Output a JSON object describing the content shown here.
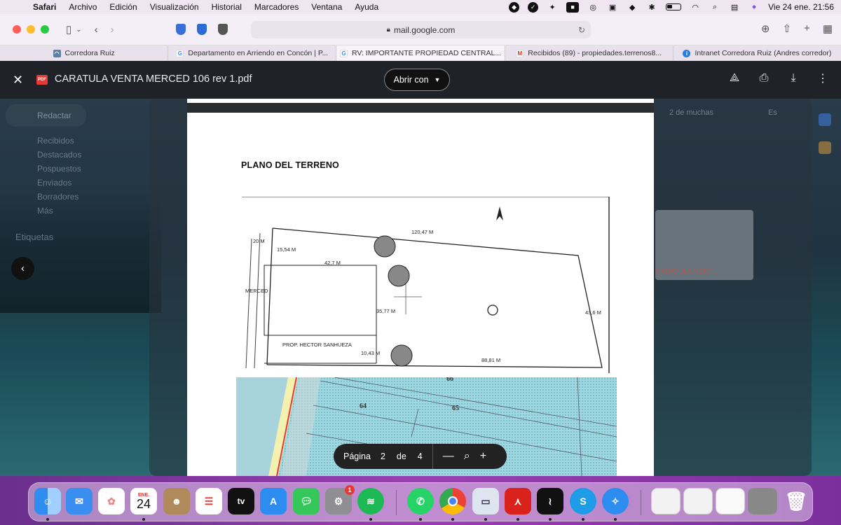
{
  "menubar": {
    "app": "Safari",
    "items": [
      "Archivo",
      "Edición",
      "Visualización",
      "Historial",
      "Marcadores",
      "Ventana",
      "Ayuda"
    ],
    "clock": "Vie 24 ene.  21:56"
  },
  "toolbar": {
    "url": "mail.google.com"
  },
  "tabs": [
    {
      "title": "Corredora Ruiz",
      "favicon": "corredora-icon"
    },
    {
      "title": "Departamento en Arriendo en Concón | P...",
      "favicon": "google-icon"
    },
    {
      "title": "RV: IMPORTANTE PROPIEDAD CENTRAL...",
      "favicon": "google-icon"
    },
    {
      "title": "Recibidos (89) - propiedades.terrenos8...",
      "favicon": "gmail-icon"
    },
    {
      "title": "Intranet Corredora Ruiz (Andres corredor)",
      "favicon": "intranet-icon"
    }
  ],
  "gmail": {
    "compose": "Redactar",
    "folders": [
      "Recibidos",
      "Destacados",
      "Pospuestos",
      "Enviados",
      "Borradores",
      "Más"
    ],
    "labels": "Etiquetas",
    "pager": "2 de muchas",
    "lang": "Es",
    "attachment": "CARATULA VENT..."
  },
  "viewer": {
    "filename": "CARATULA VENTA MERCED 106 rev 1.pdf",
    "open_with": "Abrir con"
  },
  "pdf": {
    "title": "PLANO DEL TERRENO",
    "labels": {
      "top": "120,47 M",
      "front": "20 M",
      "left_top": "15,54 M",
      "inner_top": "42,7 M",
      "inner_side": "35,77 M",
      "right": "43,6 M",
      "street": "MERCED",
      "neighbor": "PROP. HECTOR SANHUEZA",
      "bottom_left": "10,43 M",
      "bottom": "88,81 M"
    },
    "map_lots": [
      "64",
      "65",
      "66"
    ]
  },
  "pager": {
    "label": "Página",
    "current": "2",
    "of": "de",
    "total": "4"
  },
  "dock": {
    "calendar_month": "ENE.",
    "calendar_day": "24",
    "tv_label": "tv",
    "settings_badge": "1"
  }
}
